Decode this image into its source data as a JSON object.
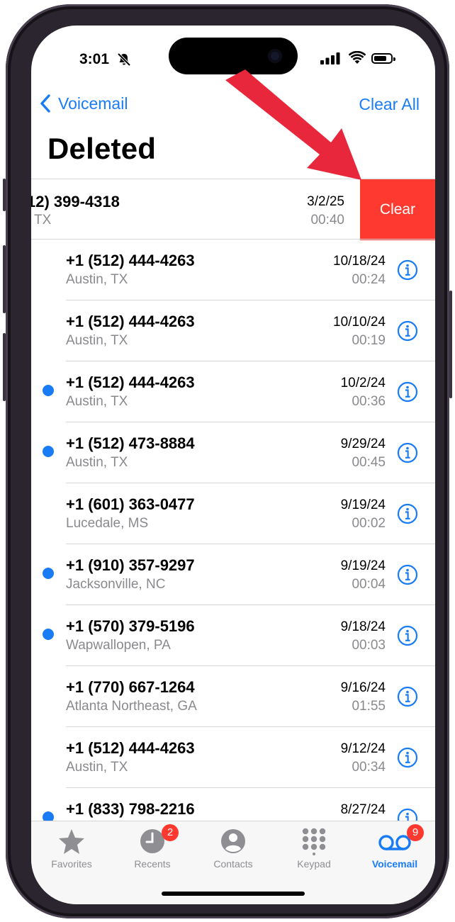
{
  "status": {
    "time": "3:01"
  },
  "nav": {
    "back_label": "Voicemail",
    "action_label": "Clear All"
  },
  "page": {
    "title": "Deleted"
  },
  "swiped_row": {
    "number": "12) 399-4318",
    "location": "TX",
    "date": "3/2/25",
    "duration": "00:40",
    "action_label": "Clear"
  },
  "voicemails": [
    {
      "unread": false,
      "number": "+1 (512) 444-4263",
      "location": "Austin, TX",
      "date": "10/18/24",
      "duration": "00:24"
    },
    {
      "unread": false,
      "number": "+1 (512) 444-4263",
      "location": "Austin, TX",
      "date": "10/10/24",
      "duration": "00:19"
    },
    {
      "unread": true,
      "number": "+1 (512) 444-4263",
      "location": "Austin, TX",
      "date": "10/2/24",
      "duration": "00:36"
    },
    {
      "unread": true,
      "number": "+1 (512) 473-8884",
      "location": "Austin, TX",
      "date": "9/29/24",
      "duration": "00:45"
    },
    {
      "unread": false,
      "number": "+1 (601) 363-0477",
      "location": "Lucedale, MS",
      "date": "9/19/24",
      "duration": "00:02"
    },
    {
      "unread": true,
      "number": "+1 (910) 357-9297",
      "location": "Jacksonville, NC",
      "date": "9/19/24",
      "duration": "00:04"
    },
    {
      "unread": true,
      "number": "+1 (570) 379-5196",
      "location": "Wapwallopen, PA",
      "date": "9/18/24",
      "duration": "00:03"
    },
    {
      "unread": false,
      "number": "+1 (770) 667-1264",
      "location": "Atlanta Northeast, GA",
      "date": "9/16/24",
      "duration": "01:55"
    },
    {
      "unread": false,
      "number": "+1 (512) 444-4263",
      "location": "Austin, TX",
      "date": "9/12/24",
      "duration": "00:34"
    },
    {
      "unread": true,
      "number": "+1 (833) 798-2216",
      "location": "",
      "date": "8/27/24",
      "duration": ""
    }
  ],
  "tabs": [
    {
      "label": "Favorites",
      "icon": "star-icon"
    },
    {
      "label": "Recents",
      "icon": "clock-icon",
      "badge": "2"
    },
    {
      "label": "Contacts",
      "icon": "person-icon"
    },
    {
      "label": "Keypad",
      "icon": "keypad-icon"
    },
    {
      "label": "Voicemail",
      "icon": "voicemail-icon",
      "badge": "9",
      "active": true
    }
  ],
  "colors": {
    "accent": "#1a7cf5",
    "destructive": "#fe3a30",
    "arrow": "#e8273c"
  }
}
